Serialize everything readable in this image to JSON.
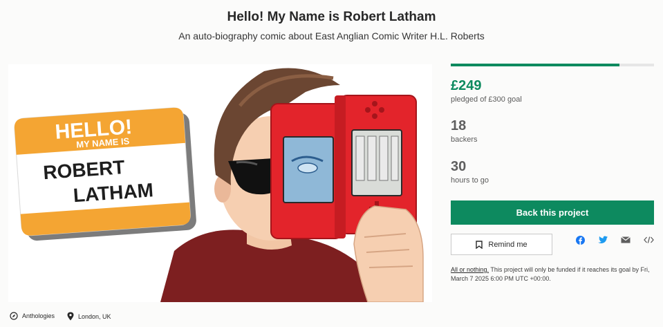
{
  "project": {
    "title": "Hello! My Name is Robert Latham",
    "subtitle": "An auto-biography comic about East Anglian Comic Writer H.L. Roberts"
  },
  "hero": {
    "badge_line1": "HELLO!",
    "badge_line2": "MY NAME IS",
    "badge_name_line1": "ROBERT",
    "badge_name_line2": "LATHAM"
  },
  "stats": {
    "pledged": {
      "value": "£249",
      "label": "pledged of £300 goal"
    },
    "backers": {
      "value": "18",
      "label": "backers"
    },
    "hours": {
      "value": "30",
      "label": "hours to go"
    },
    "progress_fraction": 0.83
  },
  "actions": {
    "back_label": "Back this project",
    "remind_label": "Remind me"
  },
  "share": {
    "icons": [
      "facebook-icon",
      "twitter-icon",
      "email-icon",
      "embed-icon"
    ]
  },
  "funding_note": {
    "link": "All or nothing.",
    "text": " This project will only be funded if it reaches its goal by Fri, March 7 2025 6:00 PM UTC +00:00."
  },
  "meta": {
    "category": "Anthologies",
    "location": "London, UK"
  },
  "colors": {
    "accent": "#0d8a5f",
    "badge_orange": "#f4a533",
    "console_red": "#e3242b"
  }
}
